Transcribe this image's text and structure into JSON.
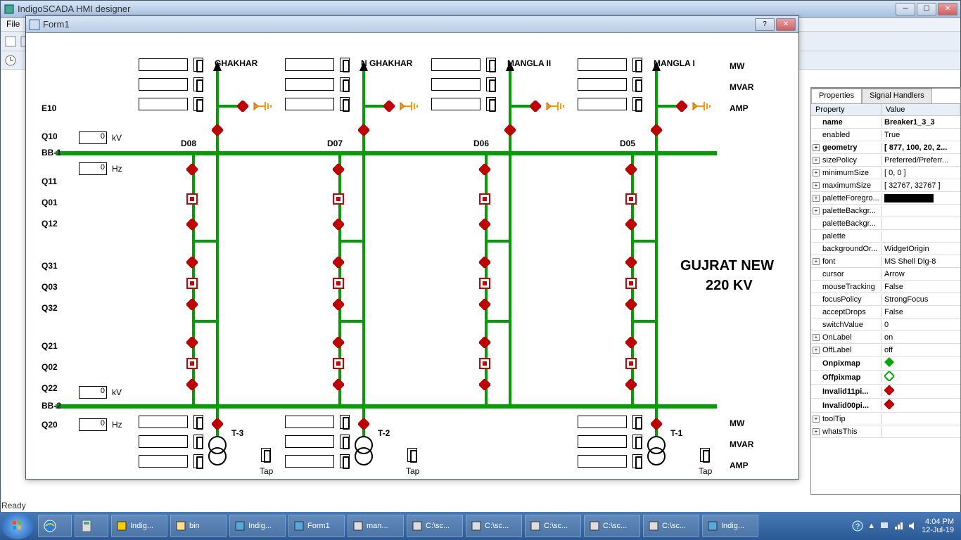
{
  "app": {
    "title": "IndigoSCADA HMI designer"
  },
  "menu": [
    "File"
  ],
  "form": {
    "title": "Form1"
  },
  "canvas": {
    "feeders": [
      "GHAKHAR",
      "N GHAKHAR",
      "MANGLA II",
      "MANGLA I"
    ],
    "units_right": [
      "MW",
      "MVAR",
      "AMP"
    ],
    "site_name": "GUJRAT NEW",
    "site_kv": "220 KV",
    "rows_left": [
      "E10",
      "Q10",
      "BB-1",
      "Q11",
      "Q01",
      "Q12",
      "Q31",
      "Q03",
      "Q32",
      "Q21",
      "Q02",
      "Q22",
      "BB-2",
      "Q20"
    ],
    "kv_label": "kV",
    "hz_label": "Hz",
    "bay_ids": [
      "D08",
      "D07",
      "D06",
      "D05"
    ],
    "xfmrs": [
      "T-3",
      "T-2",
      "T-1"
    ],
    "tap_label": "Tap",
    "bottom_units": [
      "MW",
      "MVAR",
      "AMP"
    ],
    "kv_val": "0",
    "hz_val": "0"
  },
  "props": {
    "tab1": "Properties",
    "tab2": "Signal Handlers",
    "col1": "Property",
    "col2": "Value",
    "rows": [
      {
        "k": "name",
        "v": "Breaker1_3_3",
        "b": true,
        "exp": false,
        "sel": true
      },
      {
        "k": "enabled",
        "v": "True"
      },
      {
        "k": "geometry",
        "v": "[ 877, 100, 20, 2...",
        "b": true,
        "exp": true
      },
      {
        "k": "sizePolicy",
        "v": "Preferred/Preferr...",
        "exp": true
      },
      {
        "k": "minimumSize",
        "v": "[ 0, 0 ]",
        "exp": true
      },
      {
        "k": "maximumSize",
        "v": "[ 32767, 32767 ]",
        "exp": true
      },
      {
        "k": "paletteForegro...",
        "v": "",
        "swatch": "#000",
        "exp": true
      },
      {
        "k": "paletteBackgr...",
        "v": "",
        "exp": true
      },
      {
        "k": "paletteBackgr...",
        "v": ""
      },
      {
        "k": "palette",
        "v": ""
      },
      {
        "k": "backgroundOr...",
        "v": "WidgetOrigin"
      },
      {
        "k": "font",
        "v": "MS Shell Dlg-8",
        "exp": true
      },
      {
        "k": "cursor",
        "v": "Arrow"
      },
      {
        "k": "mouseTracking",
        "v": "False"
      },
      {
        "k": "focusPolicy",
        "v": "StrongFocus"
      },
      {
        "k": "acceptDrops",
        "v": "False"
      },
      {
        "k": "switchValue",
        "v": "0"
      },
      {
        "k": "OnLabel",
        "v": "on",
        "exp": true
      },
      {
        "k": "OffLabel",
        "v": "off",
        "exp": true
      },
      {
        "k": "Onpixmap",
        "v": "",
        "b": true,
        "pix": "on"
      },
      {
        "k": "Offpixmap",
        "v": "",
        "b": true,
        "pix": "off"
      },
      {
        "k": "Invalid11pi...",
        "v": "",
        "b": true,
        "pix": "inv"
      },
      {
        "k": "Invalid00pi...",
        "v": "",
        "b": true,
        "pix": "inv"
      },
      {
        "k": "toolTip",
        "v": "",
        "exp": true
      },
      {
        "k": "whatsThis",
        "v": "",
        "exp": true
      }
    ]
  },
  "status": "Ready",
  "taskbar": {
    "items": [
      "Indig...",
      "bin",
      "Indig...",
      "Form1",
      "man...",
      "C:\\sc...",
      "C:\\sc...",
      "C:\\sc...",
      "C:\\sc...",
      "C:\\sc...",
      "Indig..."
    ],
    "time": "4:04 PM",
    "date": "12-Jul-19"
  }
}
